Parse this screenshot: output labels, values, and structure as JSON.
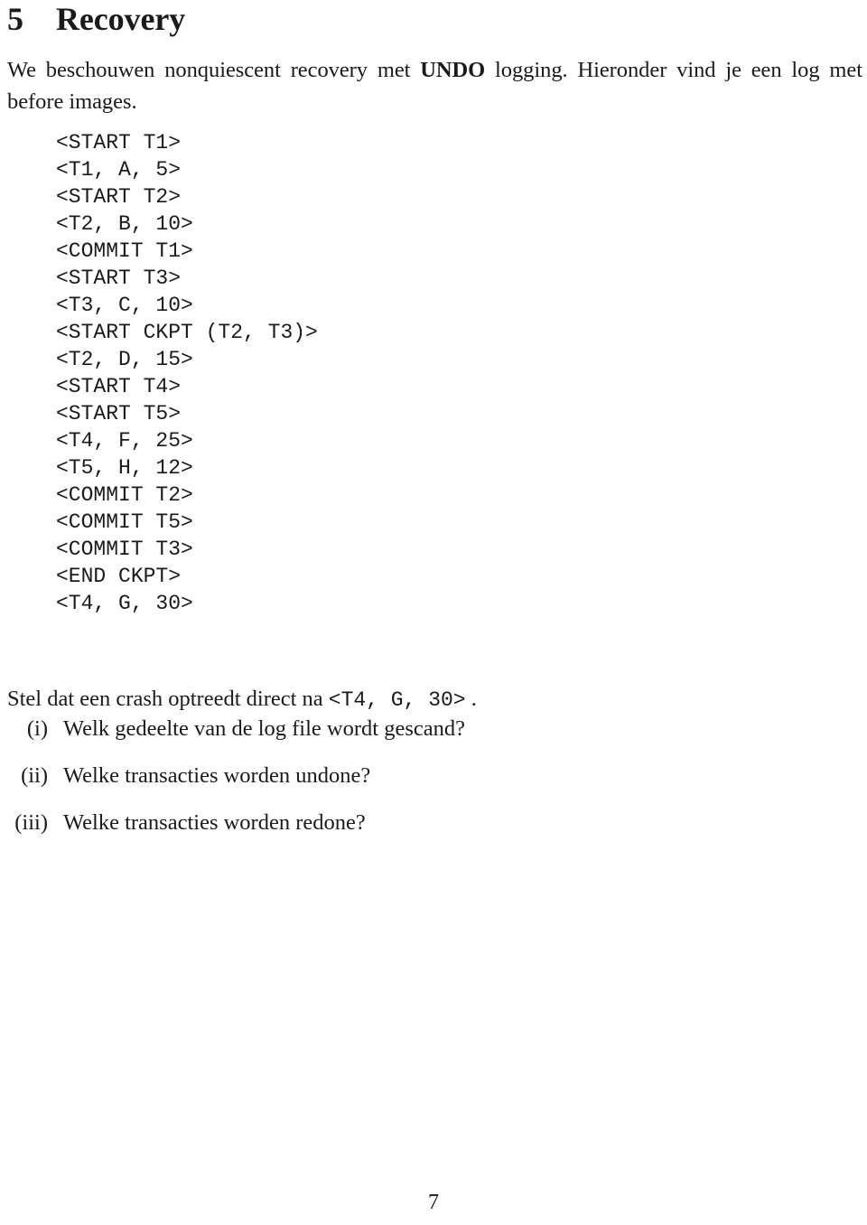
{
  "document": {
    "language": "nl",
    "page_number": "7",
    "text_color": "#1a1a1a",
    "background_color": "#ffffff"
  },
  "section": {
    "number": "5",
    "title": "Recovery"
  },
  "intro": {
    "text_before_bold": "We beschouwen nonquiescent recovery met ",
    "bold_term": "UNDO",
    "text_after_bold": " logging. Hieronder vind je een log met before images."
  },
  "log": {
    "lines": [
      "<START T1>",
      "<T1, A, 5>",
      "<START T2>",
      "<T2, B, 10>",
      "<COMMIT T1>",
      "<START T3>",
      "<T3, C, 10>",
      "<START CKPT (T2, T3)>",
      "<T2, D, 15>",
      "<START T4>",
      "<START T5>",
      "<T4, F, 25>",
      "<T5, H, 12>",
      "<COMMIT T2>",
      "<COMMIT T5>",
      "<COMMIT T3>",
      "<END CKPT>",
      "<T4, G, 30>"
    ]
  },
  "crash": {
    "text_before_code": "Stel dat een crash optreedt direct na ",
    "code": "<T4, G, 30>",
    "text_after_code": " ."
  },
  "questions": [
    {
      "marker": "(i)",
      "text": "Welk gedeelte van de log file wordt gescand?"
    },
    {
      "marker": "(ii)",
      "text": "Welke transacties worden undone?"
    },
    {
      "marker": "(iii)",
      "text": "Welke transacties worden redone?"
    }
  ]
}
